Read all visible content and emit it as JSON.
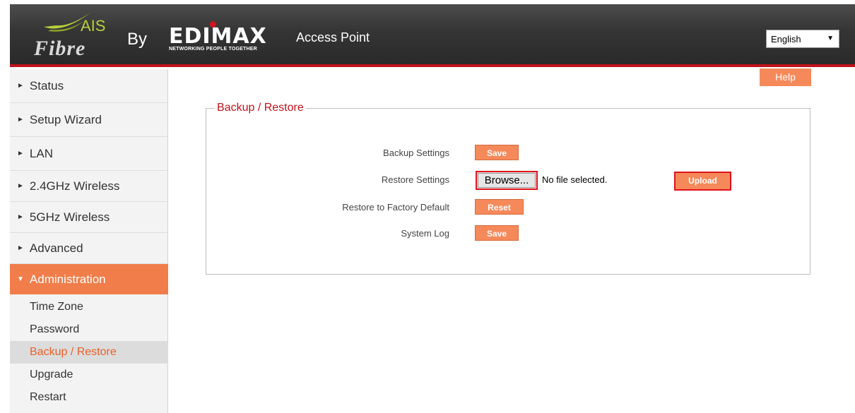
{
  "header": {
    "logo_ais": "AIS",
    "logo_fibre": "Fibre",
    "by": "By",
    "brand": "EDIMAX",
    "brand_tagline": "NETWORKING PEOPLE TOGETHER",
    "title": "Access Point",
    "language": "English"
  },
  "sidebar": {
    "items": [
      {
        "label": "Status"
      },
      {
        "label": "Setup Wizard"
      },
      {
        "label": "LAN"
      },
      {
        "label": "2.4GHz Wireless"
      },
      {
        "label": "5GHz Wireless"
      },
      {
        "label": "Advanced"
      },
      {
        "label": "Administration"
      }
    ],
    "subitems": [
      {
        "label": "Time Zone"
      },
      {
        "label": "Password"
      },
      {
        "label": "Backup / Restore"
      },
      {
        "label": "Upgrade"
      },
      {
        "label": "Restart"
      }
    ]
  },
  "help_label": "Help",
  "panel": {
    "title": "Backup / Restore",
    "rows": [
      {
        "label": "Backup Settings",
        "button": "Save"
      },
      {
        "label": "Restore Settings",
        "browse": "Browse...",
        "file_status": "No file selected.",
        "upload": "Upload"
      },
      {
        "label": "Restore to Factory Default",
        "button": "Reset"
      },
      {
        "label": "System Log",
        "button": "Save"
      }
    ]
  },
  "colors": {
    "accent": "#f07d4a",
    "header_bg": "#333333",
    "header_stripe": "#c0121b",
    "highlight_border": "#e0141c"
  }
}
